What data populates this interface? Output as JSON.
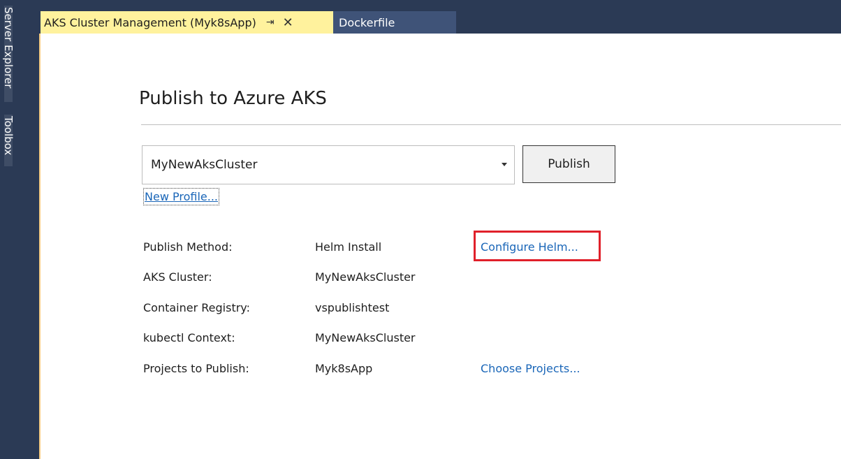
{
  "side_panels": {
    "server_explorer": "Server Explorer",
    "toolbox": "Toolbox"
  },
  "tabs": [
    {
      "label": "AKS Cluster Management (Myk8sApp)",
      "pin_icon": "pin-icon",
      "close_icon": "close-icon"
    },
    {
      "label": "Dockerfile"
    }
  ],
  "page": {
    "title": "Publish to Azure AKS",
    "profile_selected": "MyNewAksCluster",
    "publish_label": "Publish",
    "new_profile_label": "New Profile..."
  },
  "properties": [
    {
      "label": "Publish Method:",
      "value": "Helm Install",
      "action": "Configure Helm..."
    },
    {
      "label": "AKS Cluster:",
      "value": "MyNewAksCluster",
      "action": ""
    },
    {
      "label": "Container Registry:",
      "value": "vspublishtest",
      "action": ""
    },
    {
      "label": "kubectl Context:",
      "value": "MyNewAksCluster",
      "action": ""
    },
    {
      "label": "Projects to Publish:",
      "value": "Myk8sApp",
      "action": "Choose Projects..."
    }
  ],
  "colors": {
    "chrome": "#2b3a55",
    "active_tab": "#fff29d",
    "inactive_tab": "#3f5378",
    "link": "#1a66b8",
    "highlight": "#e0202a"
  }
}
